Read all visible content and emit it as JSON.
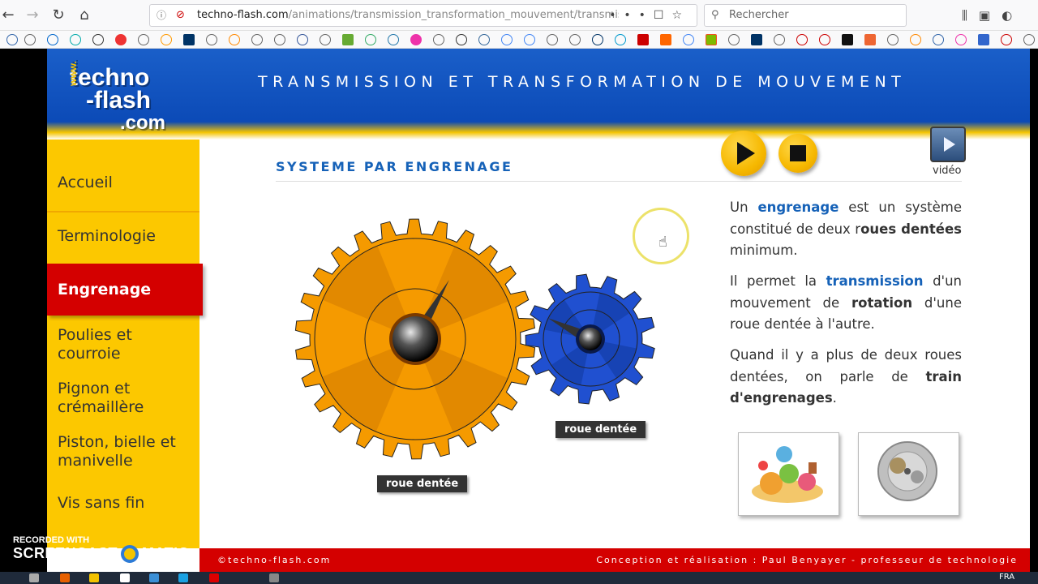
{
  "browser": {
    "url_host": "techno-flash.com",
    "url_path": "/animations/transmission_transformation_mouvement/transmission_",
    "search_placeholder": "Rechercher"
  },
  "header": {
    "logo_line1": "techno",
    "logo_line2": "-flash",
    "logo_line3": ".com",
    "logo_www": "www.",
    "title": "TRANSMISSION ET TRANSFORMATION DE MOUVEMENT"
  },
  "sidebar": {
    "items": [
      {
        "label": "Accueil"
      },
      {
        "label": "Terminologie"
      },
      {
        "label": "Engrenage"
      },
      {
        "label": "Poulies et\ncourroie"
      },
      {
        "label": "Pignon et\ncrémaillère"
      },
      {
        "label": "Piston, bielle et\nmanivelle"
      },
      {
        "label": "Vis sans fin"
      }
    ]
  },
  "content": {
    "section_title": "SYSTEME PAR ENGRENAGE",
    "video_label": "vidéo",
    "gear_label_big": "roue dentée",
    "gear_label_small": "roue dentée",
    "para1_a": "Un ",
    "para1_b": "engrenage",
    "para1_c": " est un système constitué de deux r",
    "para1_d": "oues dentées",
    "para1_e": " minimum.",
    "para2_a": "Il permet la ",
    "para2_b": "transmission",
    "para2_c": " d'un mouvement de ",
    "para2_d": "rotation",
    "para2_e": " d'une roue dentée à l'autre.",
    "para3_a": "Quand il y a plus de deux roues dentées, on parle de ",
    "para3_b": "train d'engrenages",
    "para3_c": "."
  },
  "footer": {
    "left": "©techno-flash.com",
    "right": "Conception et réalisation : Paul Benyayer - professeur de technologie"
  },
  "overlay": {
    "recorded_with": "RECORDED WITH",
    "brand_left": "SCREENCAST",
    "brand_right": "MATIC"
  },
  "taskbar": {
    "lang": "FRA"
  },
  "colors": {
    "header_blue": "#0a48b5",
    "sidebar_yellow": "#fcc800",
    "active_red": "#d40000",
    "gear_orange": "#f59a00",
    "gear_blue": "#2050d0",
    "title_blue": "#1662b8"
  }
}
